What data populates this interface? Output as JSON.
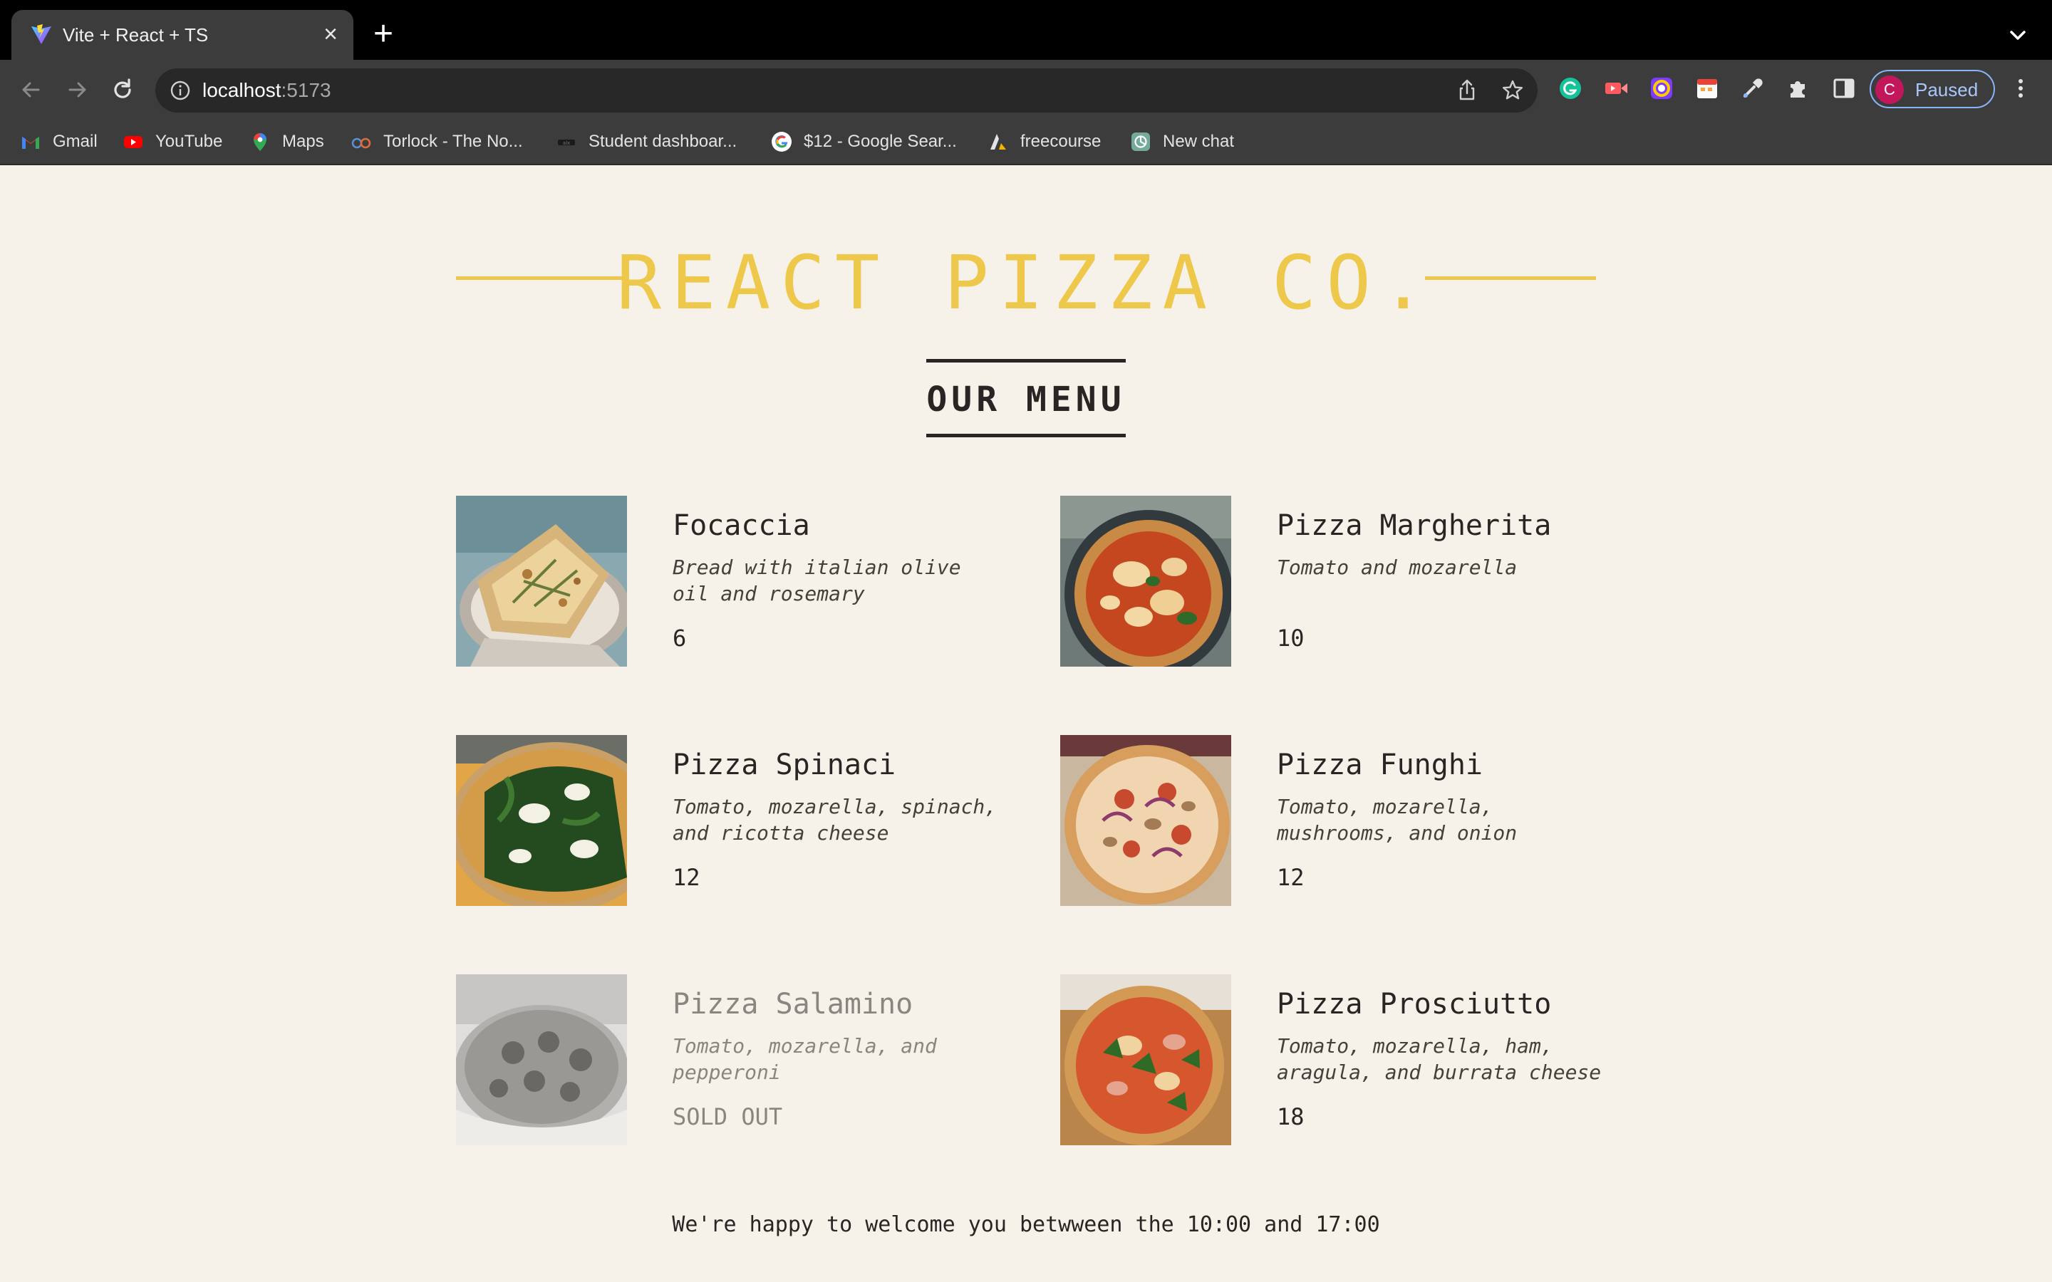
{
  "browser": {
    "tab_title": "Vite + React + TS",
    "url_host": "localhost",
    "url_port": ":5173",
    "profile_initial": "C",
    "profile_status": "Paused",
    "bookmarks": [
      {
        "label": "Gmail",
        "icon": "gmail-icon"
      },
      {
        "label": "YouTube",
        "icon": "youtube-icon"
      },
      {
        "label": "Maps",
        "icon": "maps-icon"
      },
      {
        "label": "Torlock - The No...",
        "icon": "torlock-icon"
      },
      {
        "label": "Student dashboar...",
        "icon": "student-dashboard-icon"
      },
      {
        "label": "$12 - Google Sear...",
        "icon": "google-icon"
      },
      {
        "label": "freecourse",
        "icon": "freecourse-icon"
      },
      {
        "label": "New chat",
        "icon": "chatgpt-icon"
      }
    ]
  },
  "page": {
    "title": "REACT PIZZA CO.",
    "menu_heading": "OUR MENU",
    "pizzas": [
      {
        "name": "Focaccia",
        "ingredients": "Bread with italian olive oil and rosemary",
        "price": "6",
        "sold_out": false
      },
      {
        "name": "Pizza Margherita",
        "ingredients": "Tomato and mozarella",
        "price": "10",
        "sold_out": false
      },
      {
        "name": "Pizza Spinaci",
        "ingredients": "Tomato, mozarella, spinach, and ricotta cheese",
        "price": "12",
        "sold_out": false
      },
      {
        "name": "Pizza Funghi",
        "ingredients": "Tomato, mozarella, mushrooms, and onion",
        "price": "12",
        "sold_out": false
      },
      {
        "name": "Pizza Salamino",
        "ingredients": "Tomato, mozarella, and pepperoni",
        "price": "SOLD OUT",
        "sold_out": true
      },
      {
        "name": "Pizza Prosciutto",
        "ingredients": "Tomato, mozarella, ham, aragula, and burrata cheese",
        "price": "18",
        "sold_out": false
      }
    ],
    "footer": "We're happy to welcome you betwween the 10:00 and 17:00"
  },
  "colors": {
    "background": "#f7f2e9",
    "accent_yellow": "#edc84b",
    "text_dark": "#292524",
    "sold_out_gray": "#8a8580"
  }
}
